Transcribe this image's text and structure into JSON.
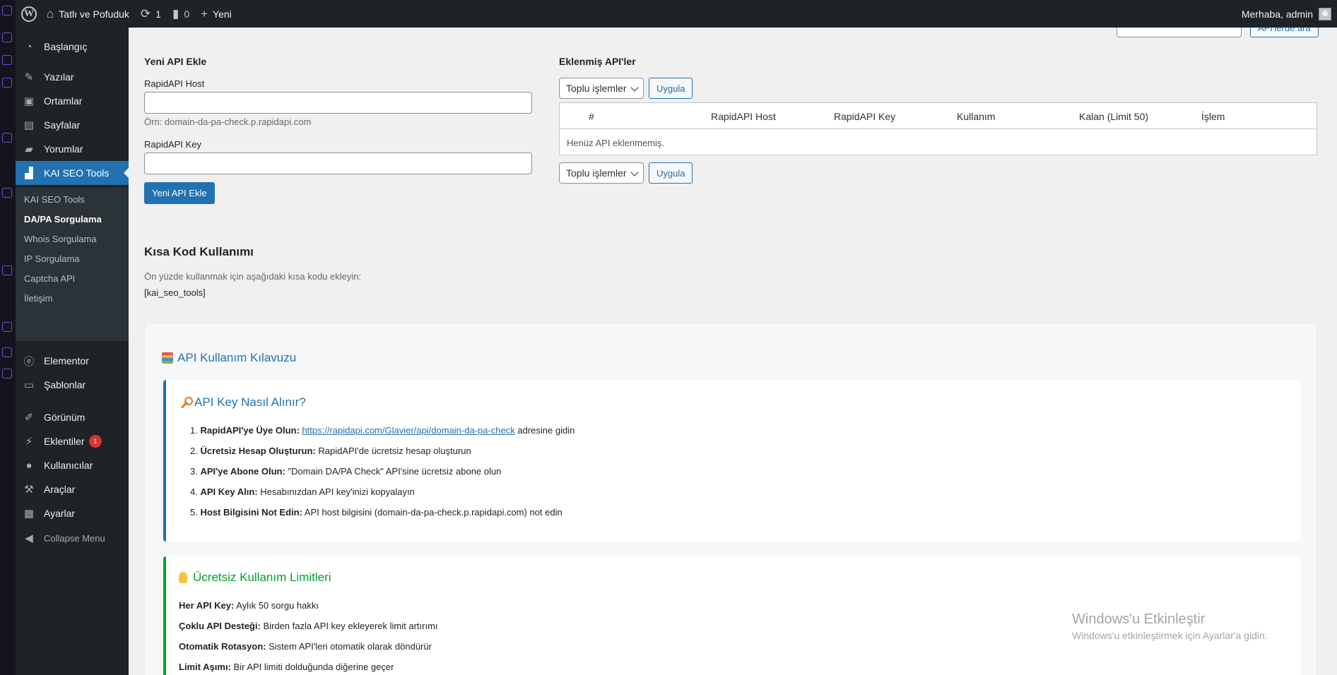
{
  "admin_bar": {
    "site_name": "Tatlı ve Pofuduk",
    "updates_count": "1",
    "comments_count": "0",
    "new_label": "Yeni",
    "greeting": "Merhaba, admin"
  },
  "menu": {
    "items": [
      {
        "label": "Başlangıç",
        "icon": "dashboard-icon"
      },
      {
        "label": "Yazılar",
        "icon": "pin-icon"
      },
      {
        "label": "Ortamlar",
        "icon": "media-icon"
      },
      {
        "label": "Sayfalar",
        "icon": "pages-icon"
      },
      {
        "label": "Yorumlar",
        "icon": "comments-icon"
      },
      {
        "label": "KAI SEO Tools",
        "icon": "chart-icon"
      },
      {
        "label": "Elementor",
        "icon": "elementor-icon"
      },
      {
        "label": "Şablonlar",
        "icon": "folder-icon"
      },
      {
        "label": "Görünüm",
        "icon": "brush-icon"
      },
      {
        "label": "Eklentiler",
        "icon": "plugin-icon",
        "badge": "1"
      },
      {
        "label": "Kullanıcılar",
        "icon": "user-icon"
      },
      {
        "label": "Araçlar",
        "icon": "wrench-icon"
      },
      {
        "label": "Ayarlar",
        "icon": "settings-icon"
      }
    ],
    "submenu": [
      "KAI SEO Tools",
      "DA/PA Sorgulama",
      "Whois Sorgulama",
      "IP Sorgulama",
      "Captcha API",
      "İletişim"
    ],
    "collapse": "Collapse Menu"
  },
  "search_button": "API'lerde ara",
  "add_form": {
    "title": "Yeni API Ekle",
    "host_label": "RapidAPI Host",
    "host_value": "",
    "host_hint": "Örn: domain-da-pa-check.p.rapidapi.com",
    "key_label": "RapidAPI Key",
    "key_value": "",
    "submit": "Yeni API Ekle"
  },
  "api_list": {
    "title": "Eklenmiş API'ler",
    "bulk_label": "Toplu işlemler",
    "apply_label": "Uygula",
    "columns": [
      "#",
      "RapidAPI Host",
      "RapidAPI Key",
      "Kullanım",
      "Kalan (Limit 50)",
      "İşlem"
    ],
    "empty": "Henüz API eklenmemiş."
  },
  "shortcode": {
    "title": "Kısa Kod Kullanımı",
    "desc": "Ön yüzde kullanmak için aşağıdaki kısa kodu ekleyin:",
    "code": "[kai_seo_tools]"
  },
  "guide": {
    "title": "API Kullanım Kılavuzu",
    "key_card": {
      "title": "API Key Nasıl Alınır?",
      "steps": [
        {
          "num": "1.",
          "bold": "RapidAPI'ye Üye Olun:",
          "link": "https://rapidapi.com/Glavier/api/domain-da-pa-check",
          "text": " adresine gidin"
        },
        {
          "num": "2.",
          "bold": "Ücretsiz Hesap Oluşturun:",
          "text": " RapidAPI'de ücretsiz hesap oluşturun"
        },
        {
          "num": "3.",
          "bold": "API'ye Abone Olun:",
          "text": " \"Domain DA/PA Check\" API'sine ücretsiz abone olun"
        },
        {
          "num": "4.",
          "bold": "API Key Alın:",
          "text": " Hesabınızdan API key'inizi kopyalayın"
        },
        {
          "num": "5.",
          "bold": "Host Bilgisini Not Edin:",
          "text": " API host bilgisini (domain-da-pa-check.p.rapidapi.com) not edin"
        }
      ]
    },
    "limits_card": {
      "title": "Ücretsiz Kullanım Limitleri",
      "items": [
        {
          "bold": "Her API Key:",
          "text": " Aylık 50 sorgu hakkı"
        },
        {
          "bold": "Çoklu API Desteği:",
          "text": " Birden fazla API key ekleyerek limit artırımı"
        },
        {
          "bold": "Otomatik Rotasyon:",
          "text": " Sistem API'leri otomatik olarak döndürür"
        },
        {
          "bold": "Limit Aşımı:",
          "text": " Bir API limiti dolduğunda diğerine geçer"
        }
      ]
    }
  },
  "watermark": {
    "title": "Windows'u Etkinleştir",
    "subtitle": "Windows'u etkinleştirmek için Ayarlar'a gidin."
  }
}
